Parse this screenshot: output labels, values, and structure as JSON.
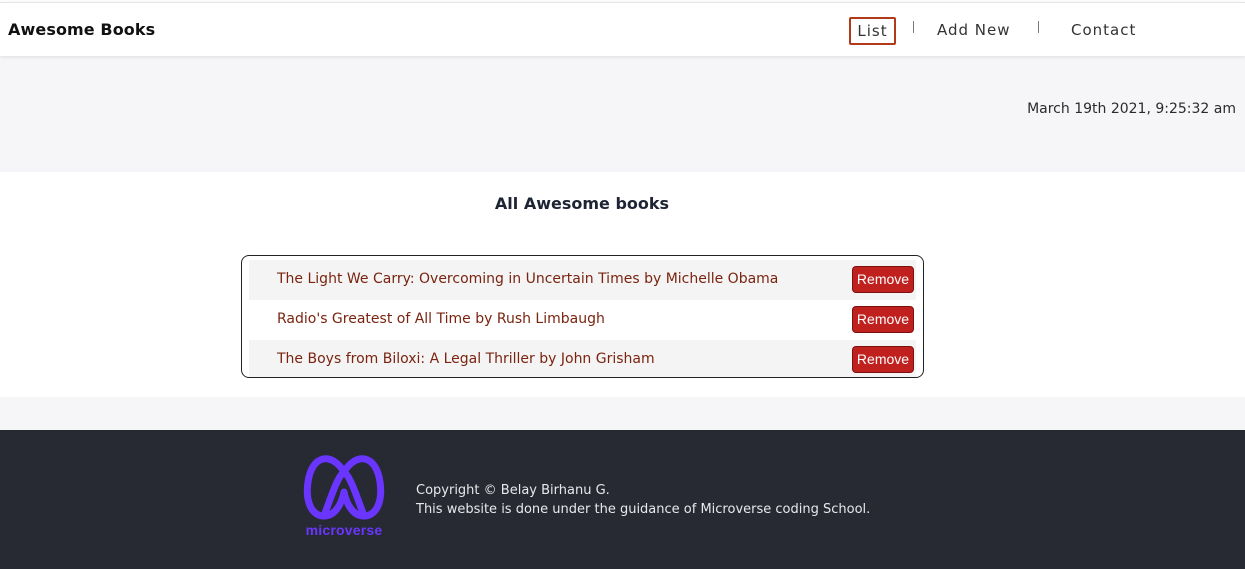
{
  "header": {
    "brand": "Awesome Books",
    "nav": {
      "list": "List",
      "add_new": "Add New",
      "contact": "Contact"
    }
  },
  "date_text": "March 19th 2021, 9:25:32 am",
  "main": {
    "title": "All Awesome books",
    "books": [
      {
        "text": "The Light We Carry: Overcoming in Uncertain Times by Michelle Obama",
        "button": "Remove"
      },
      {
        "text": "Radio's Greatest of All Time by Rush Limbaugh",
        "button": "Remove"
      },
      {
        "text": "The Boys from Biloxi: A Legal Thriller by John Grisham",
        "button": "Remove"
      }
    ]
  },
  "footer": {
    "logo_text": "microverse",
    "copyright": "Copyright © Belay Birhanu G.",
    "note": "This website is done under the guidance of Microverse coding School."
  },
  "colors": {
    "accent": "#c0201e",
    "book_text": "#7a2410",
    "footer_bg": "#272a33",
    "logo": "#6a35ff"
  }
}
